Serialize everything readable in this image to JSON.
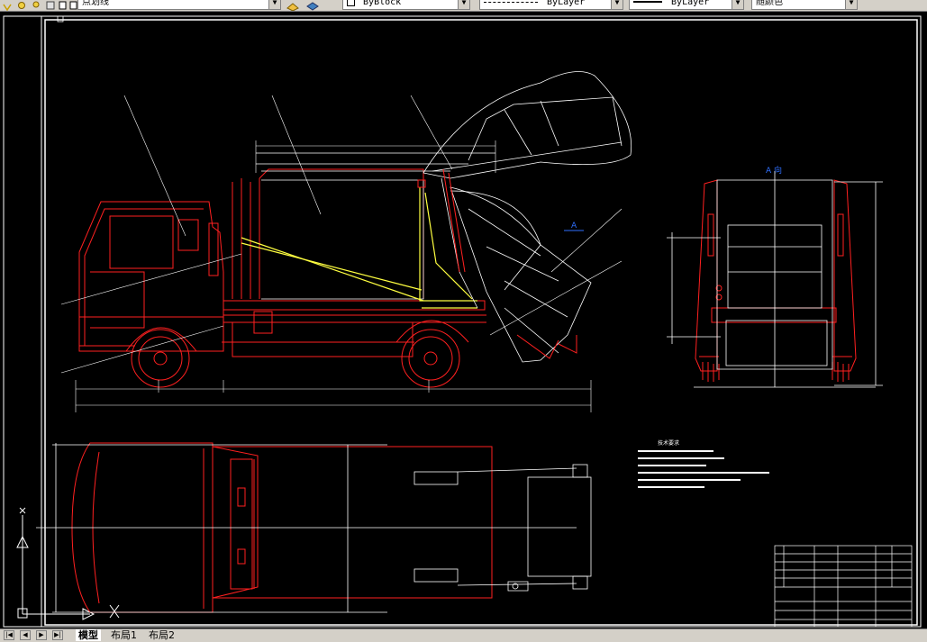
{
  "toolbar": {
    "linetype_combo": "点划线",
    "color_combo": "ByBlock",
    "linetype2_combo": "ByLayer",
    "lineweight_combo": "ByLayer",
    "plotstyle_combo": "随颜色"
  },
  "drawing": {
    "section_label": "A 向",
    "view_marker": "A",
    "tech_req_title": "技术要求",
    "ucs_x": "X",
    "ucs_y": "Y"
  },
  "tabs": {
    "model": "模型",
    "layout1": "布局1",
    "layout2": "布局2"
  },
  "colors": {
    "truck_red": "#ff2020",
    "body_white": "#ffffff",
    "frame_yellow": "#ffff40",
    "label_blue": "#3070ff"
  }
}
